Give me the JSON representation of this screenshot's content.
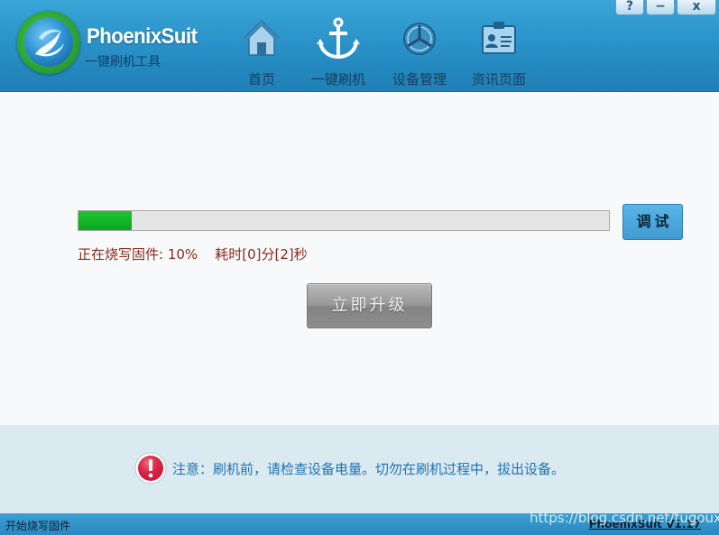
{
  "brand": {
    "name": "PhoenixSuit",
    "tagline": "一键刷机工具"
  },
  "nav": {
    "items": [
      {
        "label": "首页",
        "icon": "home-icon"
      },
      {
        "label": "一键刷机",
        "icon": "anchor-icon"
      },
      {
        "label": "设备管理",
        "icon": "device-icon"
      },
      {
        "label": "资讯页面",
        "icon": "id-card-icon"
      }
    ]
  },
  "window_controls": {
    "help": "?",
    "minimize": "−",
    "close": "x"
  },
  "flash": {
    "progress_percent": 10,
    "status_text": "正在烧写固件: 10%    耗时[0]分[2]秒",
    "debug_label": "调试",
    "upgrade_label": "立即升级"
  },
  "notice": {
    "text": "注意：刷机前，请检查设备电量。切勿在刷机过程中，拔出设备。"
  },
  "statusbar": {
    "left": "开始烧写固件",
    "right": "PhoenixSuit V1.17"
  },
  "watermark": "https://blog.csdn.net/tugouxp",
  "colors": {
    "header": "#2a93c9",
    "progress_fill": "#0aa520",
    "status_text": "#8a2a1a",
    "notice_text": "#1f73b0",
    "notice_bg": "#dbe9f1"
  }
}
